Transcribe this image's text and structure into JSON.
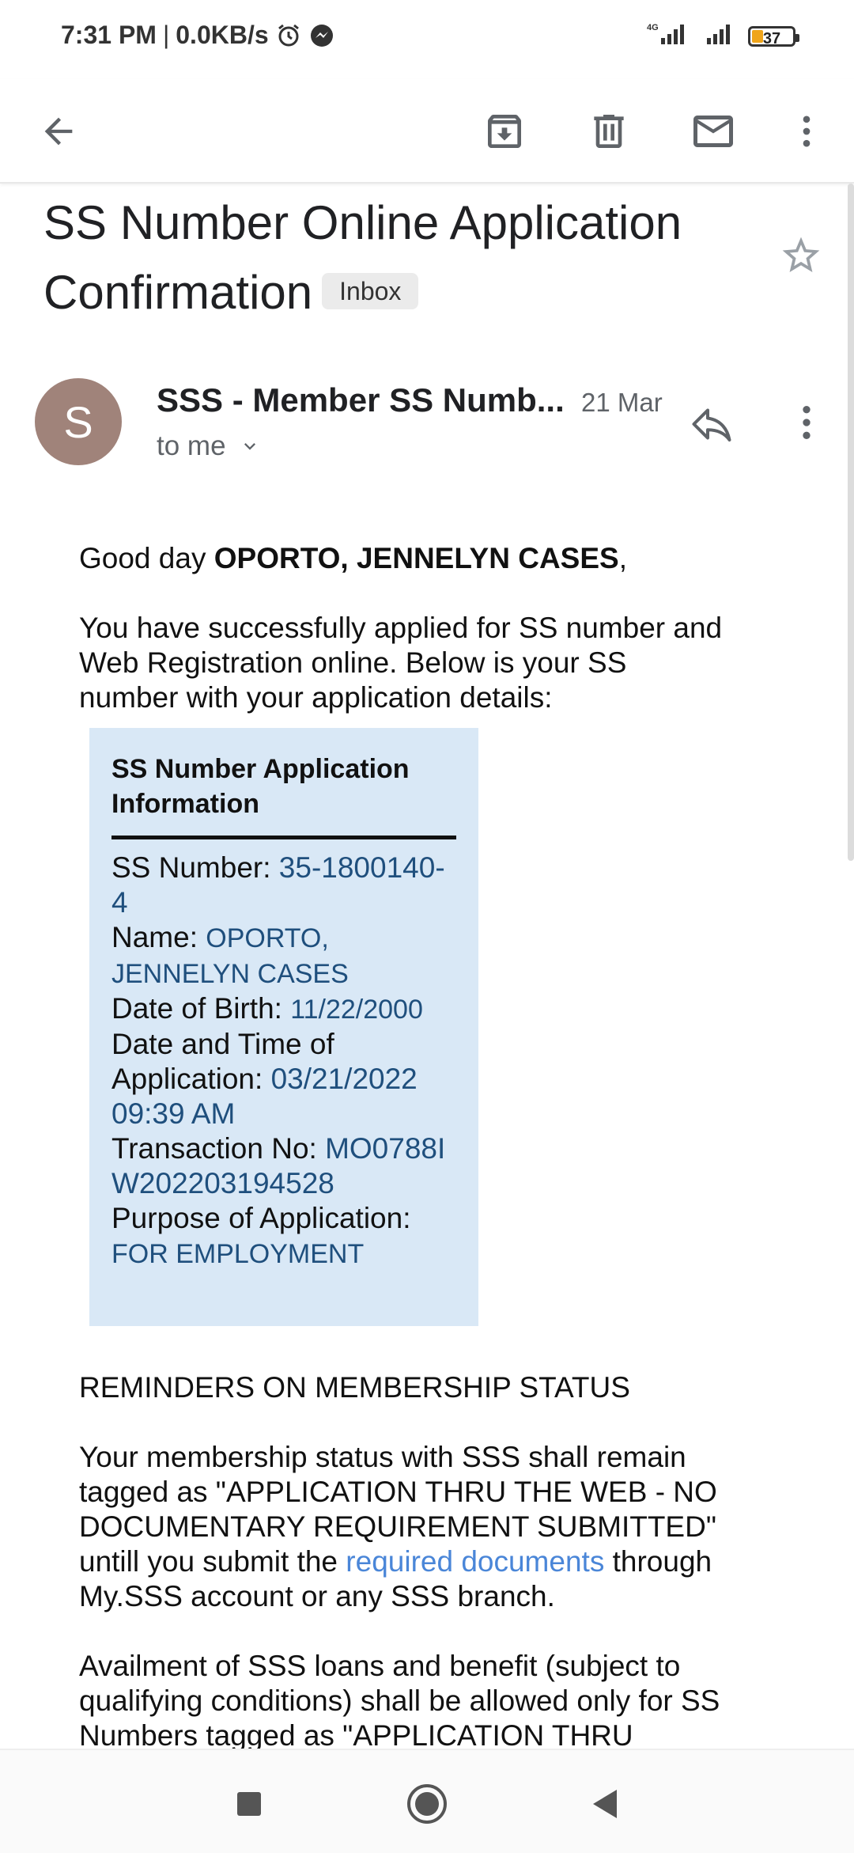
{
  "status_bar": {
    "time": "7:31 PM",
    "separator": "|",
    "speed": "0.0KB/s",
    "network": "4G",
    "battery": "37"
  },
  "toolbar": {
    "back_icon": "arrow-back-icon",
    "archive_icon": "archive-icon",
    "delete_icon": "trash-icon",
    "mark_unread_icon": "mail-icon",
    "more_icon": "more-vert-icon"
  },
  "email": {
    "subject_line1": "SS Number Online Application",
    "subject_line2": "Confirmation",
    "label": "Inbox",
    "sender_initial": "S",
    "sender_name": "SSS - Member SS Numb...",
    "date": "21 Mar",
    "to": "to me",
    "greeting_prefix": "Good day ",
    "greeting_name": "OPORTO, JENNELYN CASES",
    "greeting_suffix": ",",
    "intro": "You have successfully applied for SS number and Web Registration online. Below is your SS number with your application details:",
    "info_box": {
      "title": "SS Number Application Information",
      "ss_number_label": "SS Number: ",
      "ss_number": "35-1800140-4",
      "name_label": "Name: ",
      "name": "OPORTO, JENNELYN CASES",
      "dob_label": "Date of Birth: ",
      "dob": "11/22/2000",
      "application_label": "Date and Time of Application: ",
      "application": "03/21/2022 09:39 AM",
      "transaction_label": "Transaction No: ",
      "transaction": "MO0788IW202203194528",
      "purpose_label": "Purpose of Application: ",
      "purpose": "FOR EMPLOYMENT"
    },
    "reminders_heading": "REMINDERS ON MEMBERSHIP STATUS",
    "status_text_before": "Your membership status with SSS shall remain tagged as \"APPLICATION THRU THE WEB - NO DOCUMENTARY REQUIREMENT SUBMITTED\" untill you submit the ",
    "status_link": "required documents",
    "status_text_after": " through My.SSS account or any SSS branch.",
    "availment_text": "Availment of SSS loans and benefit (subject to qualifying conditions) shall be allowed only for SS Numbers tagged as \"APPLICATION THRU"
  },
  "nav_bar": {
    "recents_icon": "square-icon",
    "home_icon": "circle-icon",
    "back_icon": "triangle-back-icon"
  }
}
